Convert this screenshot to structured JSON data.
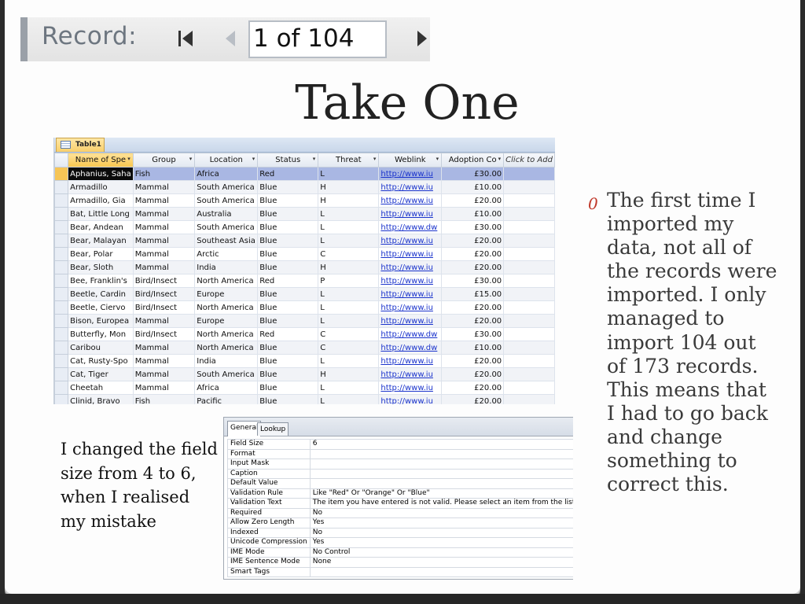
{
  "navigator": {
    "label": "Record:",
    "position_text": "1 of 104"
  },
  "slide": {
    "title": "Take One",
    "caption": "I changed the field size from 4 to 6, when I realised my mistake",
    "bullet": "The first time I imported my data, not all of the records were imported. I only managed to import 104 out of 173 records. This means that I had to go back and change something to correct this."
  },
  "datasheet": {
    "tab_label": "Table1",
    "columns": [
      "Name of Spe",
      "Group",
      "Location",
      "Status",
      "Threat",
      "Weblink",
      "Adoption Co",
      "Click to Add"
    ],
    "rows": [
      [
        "Aphanius, Saha",
        "Fish",
        "Africa",
        "Red",
        "L",
        "http://www.iu",
        "£30.00"
      ],
      [
        "Armadillo",
        "Mammal",
        "South America",
        "Blue",
        "H",
        "http://www.iu",
        "£10.00"
      ],
      [
        "Armadillo, Gia",
        "Mammal",
        "South America",
        "Blue",
        "H",
        "http://www.iu",
        "£20.00"
      ],
      [
        "Bat, Little Long",
        "Mammal",
        "Australia",
        "Blue",
        "L",
        "http://www.iu",
        "£10.00"
      ],
      [
        "Bear, Andean",
        "Mammal",
        "South America",
        "Blue",
        "L",
        "http://www.dw",
        "£30.00"
      ],
      [
        "Bear, Malayan",
        "Mammal",
        "Southeast Asia",
        "Blue",
        "L",
        "http://www.iu",
        "£20.00"
      ],
      [
        "Bear, Polar",
        "Mammal",
        "Arctic",
        "Blue",
        "C",
        "http://www.iu",
        "£20.00"
      ],
      [
        "Bear, Sloth",
        "Mammal",
        "India",
        "Blue",
        "H",
        "http://www.iu",
        "£20.00"
      ],
      [
        "Bee, Franklin's",
        "Bird/Insect",
        "North America",
        "Red",
        "P",
        "http://www.iu",
        "£30.00"
      ],
      [
        "Beetle, Cardin",
        "Bird/Insect",
        "Europe",
        "Blue",
        "L",
        "http://www.iu",
        "£15.00"
      ],
      [
        "Beetle, Ciervo",
        "Bird/Insect",
        "North America",
        "Blue",
        "L",
        "http://www.iu",
        "£20.00"
      ],
      [
        "Bison, Europea",
        "Mammal",
        "Europe",
        "Blue",
        "L",
        "http://www.iu",
        "£20.00"
      ],
      [
        "Butterfly, Mon",
        "Bird/Insect",
        "North America",
        "Red",
        "C",
        "http://www.dw",
        "£30.00"
      ],
      [
        "Caribou",
        "Mammal",
        "North America",
        "Blue",
        "C",
        "http://www.dw",
        "£10.00"
      ],
      [
        "Cat, Rusty-Spo",
        "Mammal",
        "India",
        "Blue",
        "L",
        "http://www.iu",
        "£20.00"
      ],
      [
        "Cat, Tiger",
        "Mammal",
        "South America",
        "Blue",
        "H",
        "http://www.iu",
        "£20.00"
      ],
      [
        "Cheetah",
        "Mammal",
        "Africa",
        "Blue",
        "L",
        "http://www.iu",
        "£20.00"
      ],
      [
        "Clinid, Bravo",
        "Fish",
        "Pacific",
        "Blue",
        "L",
        "http://www.iu",
        "£20.00"
      ]
    ]
  },
  "field_properties": {
    "tabs": [
      "General",
      "Lookup"
    ],
    "rows": [
      [
        "Field Size",
        "6"
      ],
      [
        "Format",
        ""
      ],
      [
        "Input Mask",
        ""
      ],
      [
        "Caption",
        ""
      ],
      [
        "Default Value",
        ""
      ],
      [
        "Validation Rule",
        "Like \"Red\" Or \"Orange\" Or \"Blue\""
      ],
      [
        "Validation Text",
        "The item you have entered is not valid. Please select an item from the list."
      ],
      [
        "Required",
        "No"
      ],
      [
        "Allow Zero Length",
        "Yes"
      ],
      [
        "Indexed",
        "No"
      ],
      [
        "Unicode Compression",
        "Yes"
      ],
      [
        "IME Mode",
        "No Control"
      ],
      [
        "IME Sentence Mode",
        "None"
      ],
      [
        "Smart Tags",
        ""
      ]
    ]
  },
  "colors": {
    "bullet_marker": "#c0392b",
    "current_row": "#a9b7e3",
    "link": "#1a33cc"
  }
}
